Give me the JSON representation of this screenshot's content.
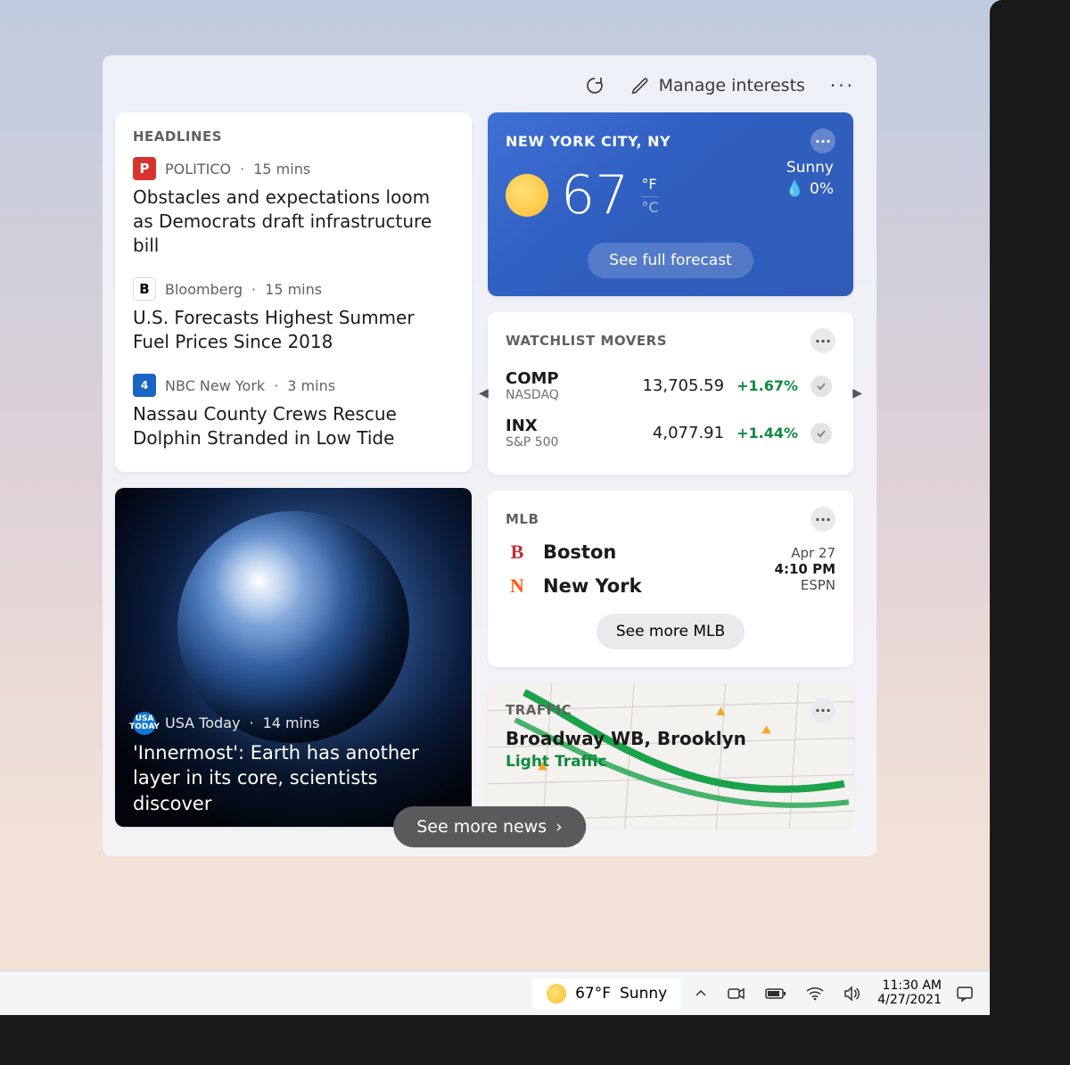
{
  "toolbar": {
    "manage_label": "Manage interests"
  },
  "headlines": {
    "title": "HEADLINES",
    "items": [
      {
        "source": "POLITICO",
        "age": "15 mins",
        "badge_text": "P",
        "badge_color": "#d7342e",
        "title": "Obstacles and expectations loom as Democrats draft infrastructure bill"
      },
      {
        "source": "Bloomberg",
        "age": "15 mins",
        "badge_text": "B",
        "badge_color": "#ffffff",
        "title": "U.S. Forecasts Highest Summer Fuel Prices Since 2018"
      },
      {
        "source": "NBC New York",
        "age": "3 mins",
        "badge_text": "4",
        "badge_color": "#1965c4",
        "title": "Nassau County Crews Rescue Dolphin Stranded in Low Tide"
      }
    ]
  },
  "photo_story": {
    "source": "USA Today",
    "age": "14 mins",
    "title": "'Innermost': Earth has another layer in its core, scientists discover"
  },
  "weather": {
    "location": "NEW YORK CITY, NY",
    "temp": "67",
    "unit_f": "°F",
    "unit_c": "°C",
    "condition": "Sunny",
    "precip": "0%",
    "forecast_button": "See full forecast"
  },
  "watchlist": {
    "title": "WATCHLIST MOVERS",
    "items": [
      {
        "symbol": "COMP",
        "name": "NASDAQ",
        "price": "13,705.59",
        "change": "+1.67%"
      },
      {
        "symbol": "INX",
        "name": "S&P 500",
        "price": "4,077.91",
        "change": "+1.44%"
      }
    ]
  },
  "mlb": {
    "title": "MLB",
    "teams": [
      {
        "name": "Boston",
        "color": "#bd3039",
        "initial": "B"
      },
      {
        "name": "New York",
        "color": "#ff5910",
        "initial": "N"
      }
    ],
    "date": "Apr 27",
    "time": "4:10 PM",
    "network": "ESPN",
    "button": "See more MLB"
  },
  "traffic": {
    "title": "TRAFFIC",
    "location": "Broadway WB, Brooklyn",
    "status": "Light Traffic",
    "status_color": "#0d8a3e"
  },
  "see_more": "See more news",
  "taskbar": {
    "temp": "67°F",
    "condition": "Sunny",
    "time": "11:30 AM",
    "date": "4/27/2021"
  }
}
